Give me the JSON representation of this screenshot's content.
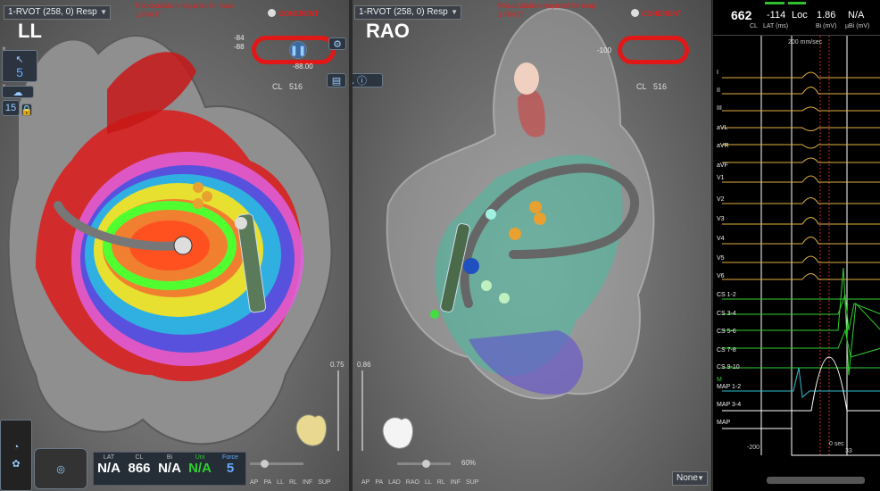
{
  "left_view": {
    "dropdown": "1-RVOT (258, 0) Resp",
    "warning": "Recalculation required for map  1-RVOT",
    "label": "LL",
    "coherent": "COHERENT",
    "ring_left_top": "-84",
    "ring_left_bot": "-88",
    "ring_right": "-88.00",
    "cl_label": "CL",
    "cl_value": "516",
    "tool_number": "5",
    "tool_number2": "15",
    "scale_value": "0.75",
    "stats": {
      "lat_label": "LAT",
      "lat_value": "N/A",
      "cl_label": "CL",
      "cl_value": "866",
      "bi_label": "Bi",
      "bi_value": "N/A",
      "uni_label": "Uni",
      "uni_value": "N/A",
      "force_label": "Force",
      "force_value": "5"
    },
    "view_buttons": [
      "AP",
      "PA",
      "LL",
      "RL",
      "INF",
      "SUP"
    ]
  },
  "mid_view": {
    "dropdown": "1-RVOT (258, 0) Resp",
    "warning": "Recalculation required for map  1-RVOT",
    "label": "RAO",
    "coherent": "COHERENT",
    "ring_left": "-100",
    "cl_label": "CL",
    "cl_value": "516",
    "scale_value": "0.86",
    "opacity_value": "60%",
    "view_buttons": [
      "AP",
      "PA",
      "LAD",
      "RAO",
      "LL",
      "RL",
      "INF",
      "SUP"
    ],
    "none_dropdown": "None"
  },
  "ecg_panel": {
    "cl_value": "662",
    "cl_label": "CL",
    "lat_value": "-114",
    "lat_label": "LAT (ms)",
    "loc_value": "Loc",
    "bi_value": "1.86",
    "bi_label": "Bi (mV)",
    "uni_value": "N/A",
    "uni_label": "µBi (mV)",
    "time_scale": "200 mm/sec",
    "leads": [
      "I",
      "II",
      "III",
      "aVL",
      "aVR",
      "aVF",
      "V1",
      "V2",
      "V3",
      "V4",
      "V5",
      "V6",
      "CS 1-2",
      "CS 3-4",
      "CS 5-6",
      "CS 7-8",
      "CS 9-10",
      "M",
      "MAP 1-2",
      "MAP 3-4",
      "MAP"
    ],
    "ticks_left": "-200",
    "ticks_mid": "0 sec",
    "ticks_right": "33"
  },
  "colors": {
    "ring": "#e01818",
    "ecg_yellow": "#e0b040",
    "ecg_green": "#2fcf2f",
    "ecg_cyan": "#30c0d0",
    "warning": "#e02020"
  }
}
